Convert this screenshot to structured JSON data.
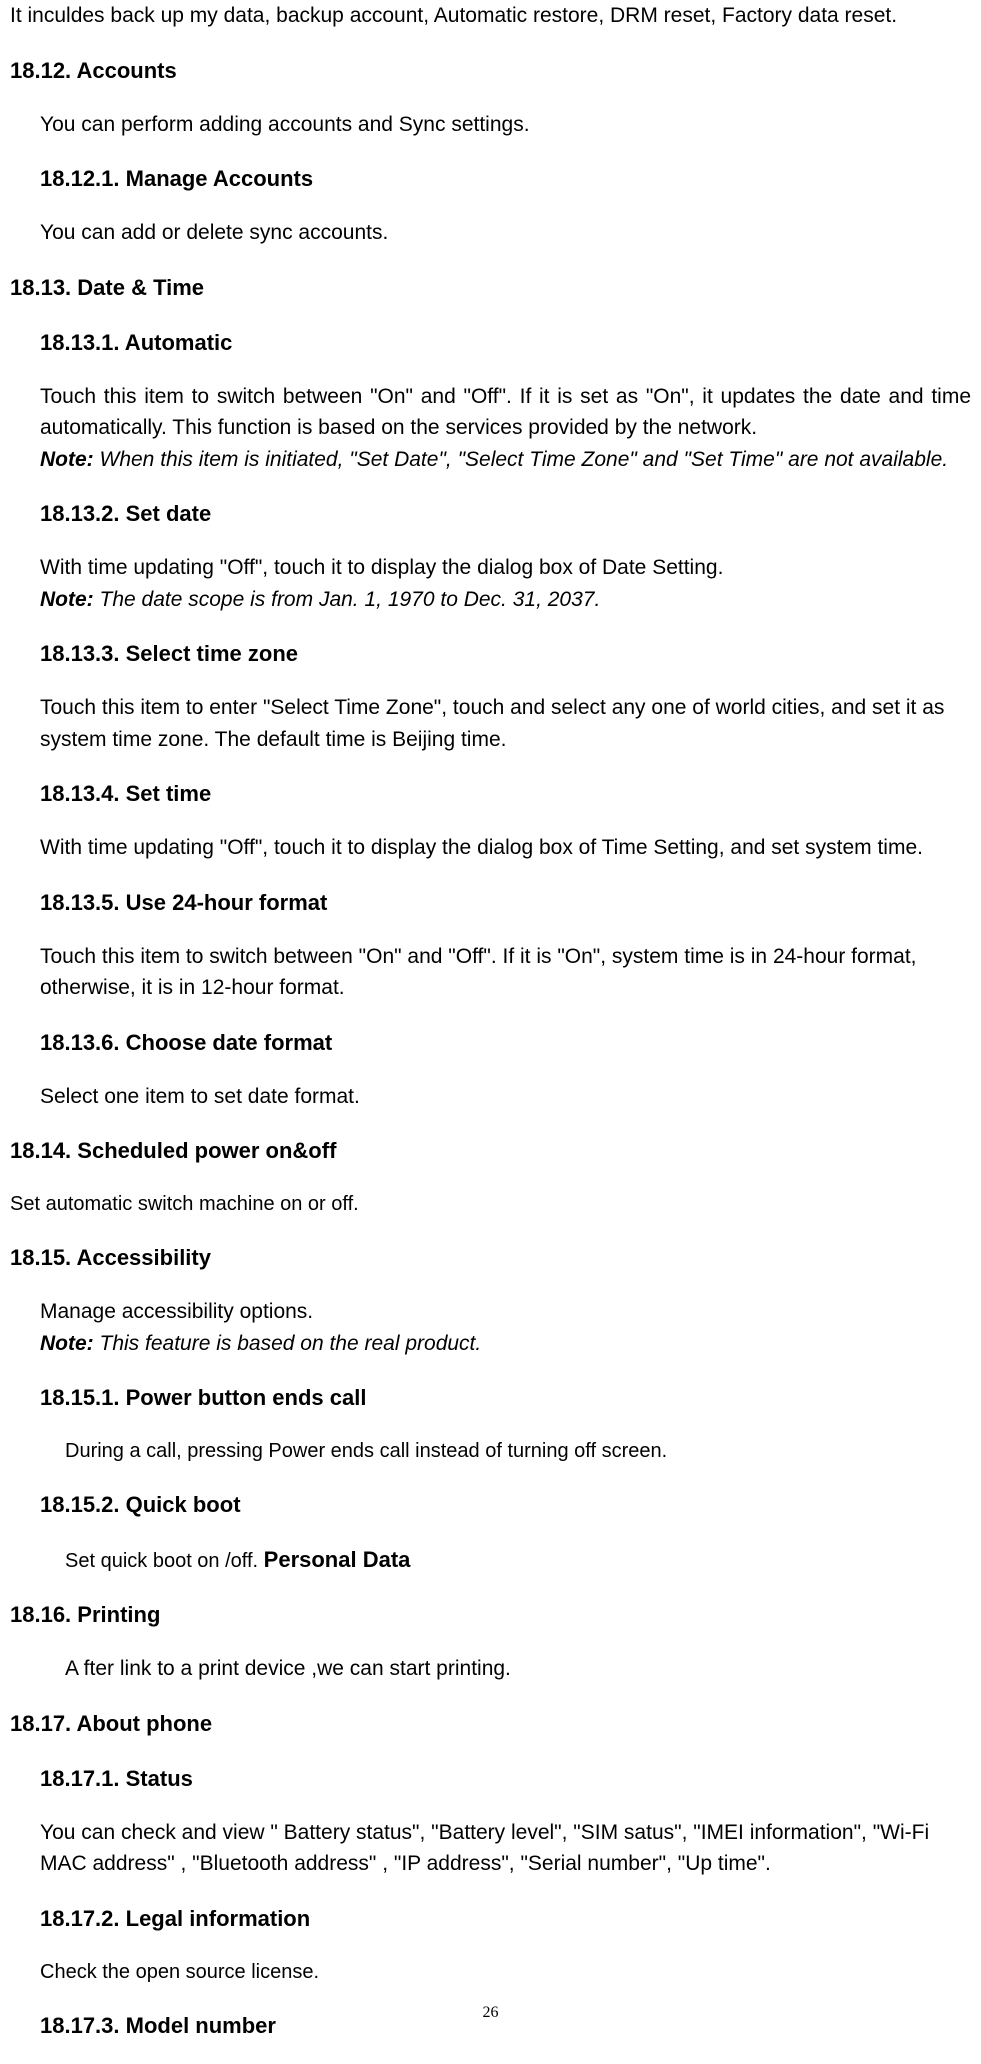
{
  "intro": "It inculdes back up my data, backup account, Automatic restore, DRM reset, Factory data reset.",
  "s12": {
    "heading": "18.12. Accounts",
    "text": "You can perform adding accounts and Sync settings.",
    "s1": {
      "heading": "18.12.1. Manage Accounts",
      "text": "You can add or delete sync accounts."
    }
  },
  "s13": {
    "heading": "18.13.    Date & Time",
    "s1": {
      "heading": "18.13.1. Automatic",
      "text": "Touch this item to switch between \"On\" and \"Off\". If it is set as \"On\", it updates the date and time automatically. This function is based on the services provided by the network.",
      "note_label": "Note:",
      "note": " When this item is initiated, \"Set Date\", \"Select Time Zone\" and \"Set Time\" are not available."
    },
    "s2": {
      "heading": "18.13.2. Set date",
      "text": "With time updating \"Off\", touch it to display the dialog box of Date Setting.",
      "note_label": "Note:",
      "note": " The date scope is from Jan. 1, 1970 to Dec. 31, 2037."
    },
    "s3": {
      "heading": "18.13.3. Select time zone",
      "text": "Touch this item to enter \"Select Time Zone\", touch and select any one of world cities, and set it as system time zone. The default time is Beijing time."
    },
    "s4": {
      "heading": "18.13.4. Set time",
      "text": "With time updating \"Off\", touch it to display the dialog box of Time Setting, and set system time."
    },
    "s5": {
      "heading": "18.13.5. Use 24-hour format",
      "text": "Touch this item to switch between \"On\" and \"Off\". If it is \"On\", system time is in 24-hour format, otherwise, it is in 12-hour format."
    },
    "s6": {
      "heading": "18.13.6. Choose date format",
      "text": "Select one item to set date format."
    }
  },
  "s14": {
    "heading": "18.14. Scheduled power on&off",
    "text": "Set automatic switch machine on or off."
  },
  "s15": {
    "heading": "18.15.  Accessibility",
    "text": "Manage accessibility options.",
    "note_label": "Note:",
    "note": " This feature is based on the real product.",
    "s1": {
      "heading": "18.15.1. Power button ends call",
      "text": "During a call, pressing Power ends call instead of turning off screen."
    },
    "s2": {
      "heading": "18.15.2. Quick boot",
      "text_prefix": "Set quick boot on /off. ",
      "text_bold": "Personal Data"
    }
  },
  "s16": {
    "heading": "18.16. Printing",
    "text": "A fter link to a print device ,we can start   printing."
  },
  "s17": {
    "heading": "18.17.    About phone",
    "s1": {
      "heading": "18.17.1. Status",
      "text": "You can check and view \" Battery status\", \"Battery level\", \"SIM satus\", \"IMEI information\", \"Wi-Fi MAC address\" , \"Bluetooth address\" , \"IP address\", \"Serial number\", \"Up time\"."
    },
    "s2": {
      "heading": "18.17.2. Legal information",
      "text": "Check the open source license."
    },
    "s3": {
      "heading": "18.17.3. Model number"
    }
  },
  "page_number": "26"
}
